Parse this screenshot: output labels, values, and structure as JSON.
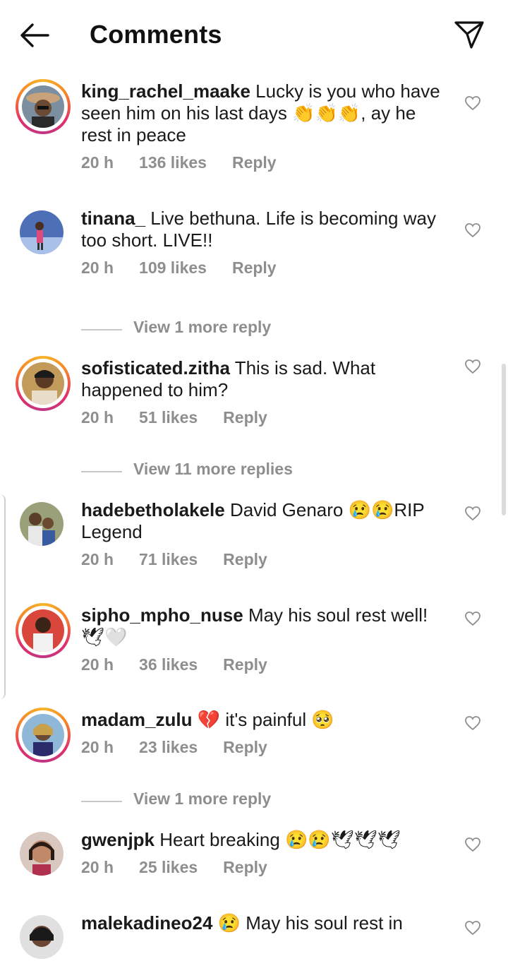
{
  "header": {
    "title": "Comments",
    "back_icon": "arrow-left-icon",
    "send_icon": "paper-plane-icon"
  },
  "comments": [
    {
      "username": "king_rachel_maake",
      "text": "Lucky is you who have seen him on his last days 👏👏👏, ay he rest in peace",
      "time": "20 h",
      "likes": "136 likes",
      "reply": "Reply",
      "ring": true
    },
    {
      "username": "tinana_",
      "text": "Live bethuna. Life is becoming way too short. LIVE!!",
      "time": "20 h",
      "likes": "109 likes",
      "reply": "Reply",
      "ring": false,
      "more": "View 1 more reply"
    },
    {
      "username": "sofisticated.zitha",
      "text": "This is sad. What happened to him?",
      "time": "20 h",
      "likes": "51 likes",
      "reply": "Reply",
      "ring": true,
      "more": "View 11 more replies"
    },
    {
      "username": "hadebetholakele",
      "text": "David Genaro 😢😢RIP Legend",
      "time": "20 h",
      "likes": "71 likes",
      "reply": "Reply",
      "ring": false
    },
    {
      "username": "sipho_mpho_nuse",
      "text": "May his soul rest well! 🕊🤍",
      "time": "20 h",
      "likes": "36 likes",
      "reply": "Reply",
      "ring": true
    },
    {
      "username": "madam_zulu",
      "text": "💔 it's painful 🥺",
      "time": "20 h",
      "likes": "23 likes",
      "reply": "Reply",
      "ring": true,
      "more": "View 1 more reply"
    },
    {
      "username": "gwenjpk",
      "text": "Heart breaking 😢😢🕊🕊🕊",
      "time": "20 h",
      "likes": "25 likes",
      "reply": "Reply",
      "ring": false
    },
    {
      "username": "malekadineo24",
      "text": "😢 May his soul rest in",
      "ring": false
    }
  ],
  "colors": {
    "meta": "#8e8e8e",
    "ring_start": "#f5b52a",
    "ring_end": "#c13584"
  }
}
